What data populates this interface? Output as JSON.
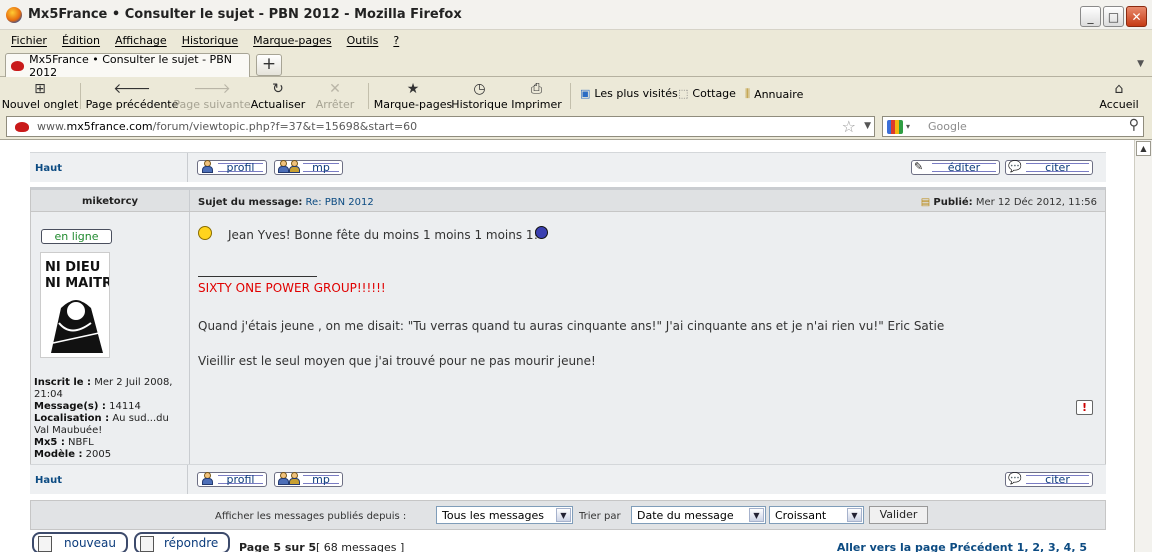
{
  "window": {
    "title": "Mx5France • Consulter le sujet - PBN 2012 - Mozilla Firefox"
  },
  "menu": [
    "Fichier",
    "Édition",
    "Affichage",
    "Historique",
    "Marque-pages",
    "Outils",
    "?"
  ],
  "tab": {
    "title": "Mx5France • Consulter le sujet - PBN 2012",
    "new_tab_symbol": "+"
  },
  "toolbar": {
    "new_tab": "Nouvel onglet",
    "back": "Page précédente",
    "forward": "Page suivante",
    "reload": "Actualiser",
    "stop": "Arrêter",
    "bookmarks": "Marque-pages",
    "history": "Historique",
    "print": "Imprimer",
    "most_visited": "Les plus visités",
    "cottage": "Cottage",
    "annuaire": "Annuaire",
    "home": "Accueil"
  },
  "address": {
    "scheme": "www.",
    "domain": "mx5france.com",
    "path": "/forum/viewtopic.php?f=37&t=15698&start=60",
    "search_placeholder": "Google"
  },
  "forum": {
    "haut": "Haut",
    "profil": "profil",
    "mp": "mp",
    "editer": "éditer",
    "citer": "citer",
    "post": {
      "author": "miketorcy",
      "subject_label": "Sujet du message:",
      "subject": "Re: PBN 2012",
      "published_label": "Publié:",
      "published": "Mer 12 Déc 2012, 11:56",
      "online": "en ligne",
      "line1": "Jean Yves! Bonne fête du moins 1 moins 1 moins 1!",
      "signature": "SIXTY ONE POWER GROUP!!!!!!",
      "line2": "Quand j'étais jeune , on me disait: \"Tu verras quand tu auras cinquante ans!\" J'ai cinquante ans et je n'ai rien vu!\" Eric Satie",
      "line3": "Vieillir est le seul moyen que j'ai trouvé pour ne pas mourir jeune!"
    },
    "user": {
      "inscrit_label": "Inscrit le :",
      "inscrit": "Mer 2 Juil 2008, 21:04",
      "messages_label": "Message(s) :",
      "messages": "14114",
      "localisation_label": "Localisation :",
      "localisation": "Au sud...du Val Maubuée!",
      "mx5_label": "Mx5 :",
      "mx5": "NBFL",
      "modele_label": "Modèle :",
      "modele": "2005"
    },
    "filter": {
      "label": "Afficher les messages publiés depuis :",
      "since": "Tous les messages",
      "sort_label": "Trier par",
      "sort": "Date du message",
      "order": "Croissant",
      "submit": "Valider"
    },
    "bottom": {
      "new": "nouveau",
      "reply": "répondre",
      "page": "Page 5 sur 5",
      "count": "[ 68 messages ]",
      "goto": "Aller vers la page Précédent  1, 2, 3, 4, 5"
    }
  },
  "colors": {
    "link": "#0c4b82",
    "signature": "#e00000",
    "online": "#208a2e"
  }
}
